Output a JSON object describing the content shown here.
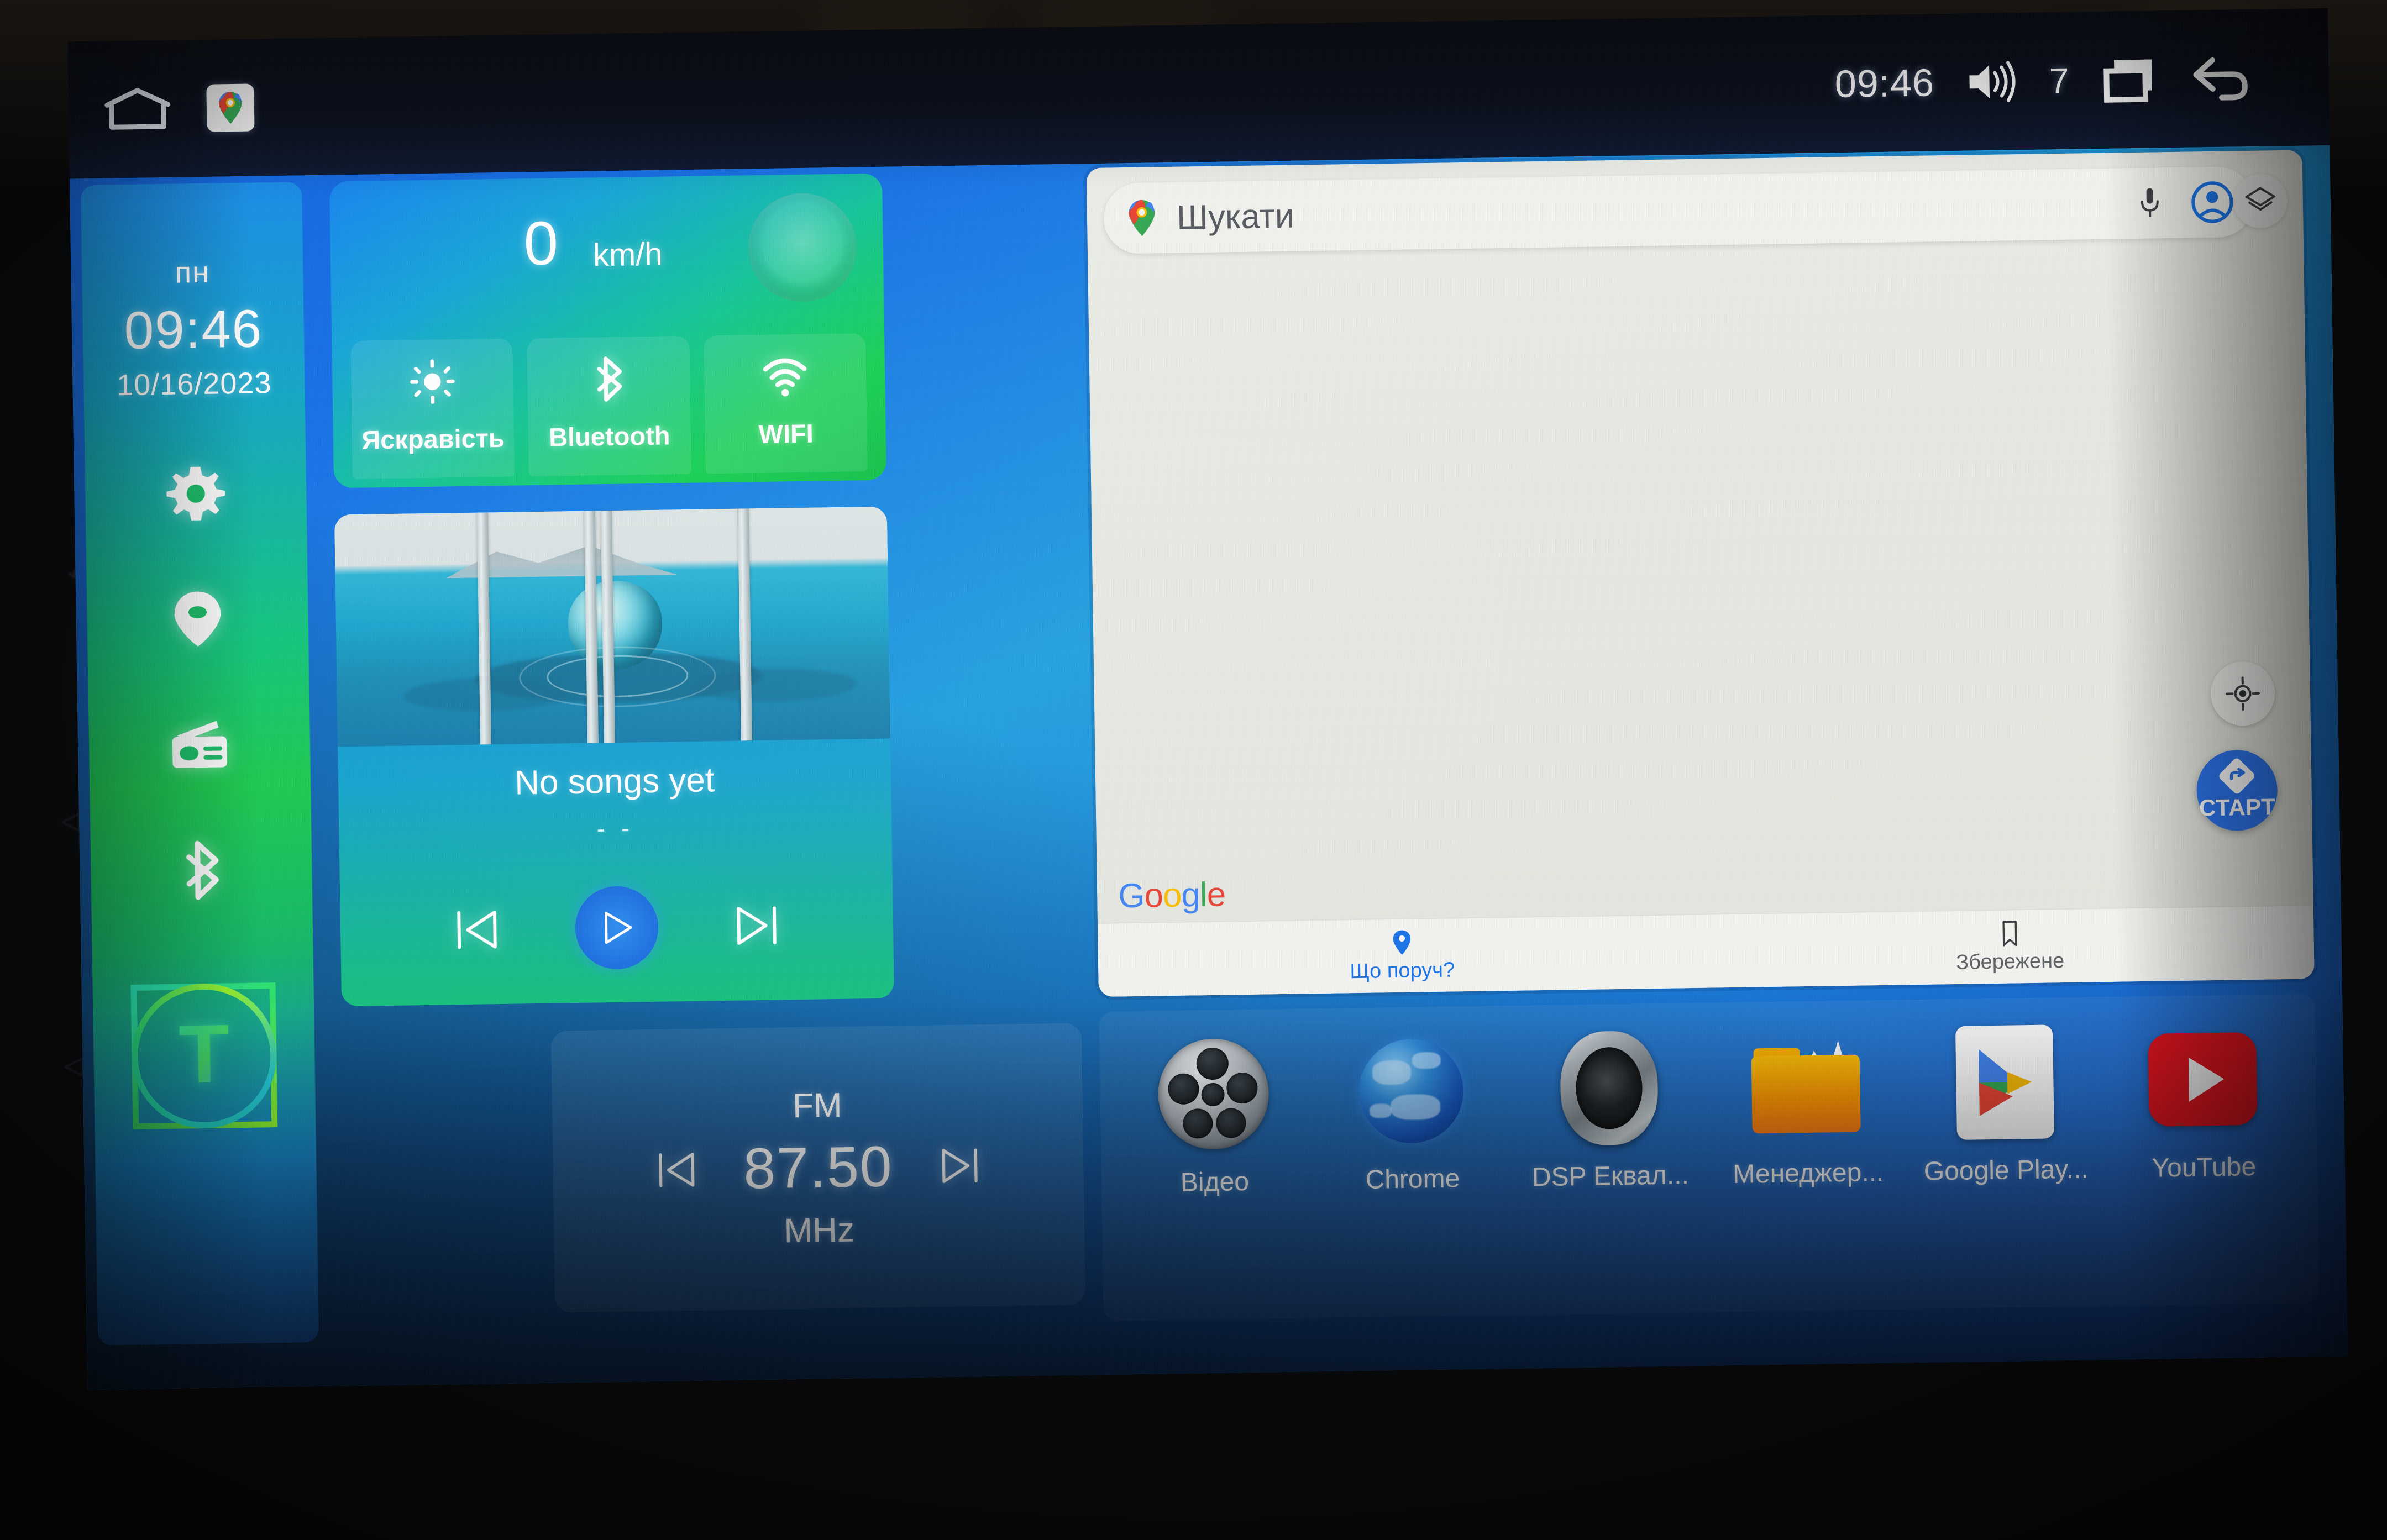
{
  "status_bar": {
    "home_icon": "home-icon",
    "maps_shortcut_icon": "google-maps-icon",
    "time": "09:46",
    "volume_icon": "volume-icon",
    "volume_level": "7",
    "recents_icon": "recent-apps-icon",
    "back_icon": "back-arrow-icon"
  },
  "rail": {
    "weekday": "пн",
    "clock": "09:46",
    "date": "10/16/2023",
    "icons": [
      {
        "name": "settings-gear-icon"
      },
      {
        "name": "location-pin-icon"
      },
      {
        "name": "radio-icon"
      },
      {
        "name": "bluetooth-icon"
      }
    ],
    "logo_letter": "T"
  },
  "quick_card": {
    "speed_value": "0",
    "speed_unit": "km/h",
    "dial_icon": "speed-dial-gauge",
    "toggles": [
      {
        "label": "Яскравість",
        "icon": "brightness-icon"
      },
      {
        "label": "Bluetooth",
        "icon": "bluetooth-icon"
      },
      {
        "label": "WIFI",
        "icon": "wifi-icon"
      }
    ]
  },
  "music": {
    "title": "No songs yet",
    "subtitle": "- -",
    "prev_icon": "skip-previous-icon",
    "play_icon": "play-icon",
    "next_icon": "skip-next-icon",
    "album_art": "water-ball-photo"
  },
  "radio": {
    "band": "FM",
    "frequency": "87.50",
    "unit": "MHz",
    "prev_icon": "tune-down-icon",
    "next_icon": "tune-up-icon"
  },
  "maps": {
    "search_placeholder": "Шукати",
    "pin_icon": "google-maps-pin-icon",
    "mic_icon": "microphone-icon",
    "avatar_icon": "account-avatar-icon",
    "layers_icon": "map-layers-icon",
    "locate_icon": "my-location-icon",
    "start_label": "СТАРТ",
    "start_icon": "navigation-diamond-icon",
    "logo": {
      "g1": "G",
      "o1": "o",
      "o2": "o",
      "g2": "g",
      "l": "l",
      "e": "e"
    },
    "bottom_bar": [
      {
        "label": "Що поруч?",
        "icon": "map-pin-icon",
        "style": "blue"
      },
      {
        "label": "Збережене",
        "icon": "bookmark-icon",
        "style": "grey"
      }
    ]
  },
  "dock": {
    "apps": [
      {
        "label": "Відео",
        "icon": "film-reel-icon"
      },
      {
        "label": "Chrome",
        "icon": "globe-browser-icon"
      },
      {
        "label": "DSP Еквал...",
        "icon": "speaker-icon"
      },
      {
        "label": "Менеджер...",
        "icon": "file-folder-icon"
      },
      {
        "label": "Google Play...",
        "icon": "google-play-icon"
      },
      {
        "label": "YouTube",
        "icon": "youtube-icon"
      }
    ]
  },
  "bezel": {
    "side_buttons": [
      {
        "name": "power-button",
        "glyph": "⏻"
      },
      {
        "name": "home-button",
        "glyph": "⌂"
      },
      {
        "name": "back-button",
        "glyph": "↶"
      },
      {
        "name": "volume-up-button",
        "glyph": "◁+"
      },
      {
        "name": "volume-down-button",
        "glyph": "◁-"
      }
    ]
  },
  "colors": {
    "accent_blue": "#1a73e8",
    "rail_green": "#1fcb52",
    "rail_blue": "#1c8ce8",
    "youtube_red": "#e5121c",
    "maps_bg": "#e9eae4"
  }
}
